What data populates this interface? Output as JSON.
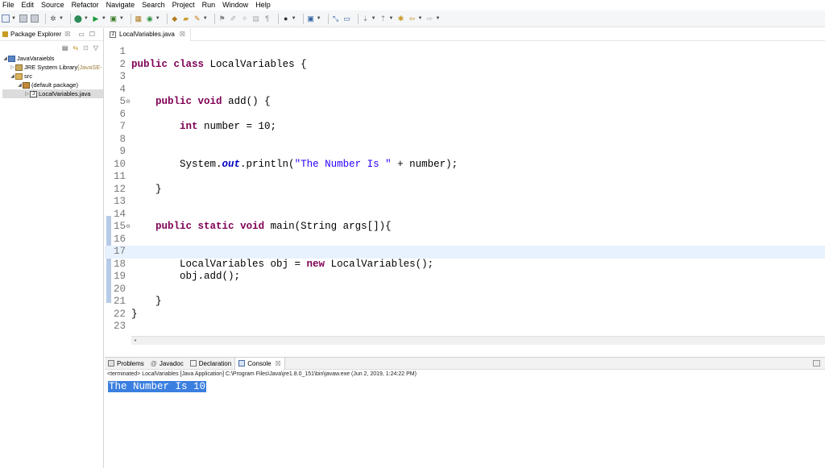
{
  "menu": [
    "File",
    "Edit",
    "Source",
    "Refactor",
    "Navigate",
    "Search",
    "Project",
    "Run",
    "Window",
    "Help"
  ],
  "package_explorer": {
    "title": "Package Explorer",
    "close": "☒",
    "tree": [
      {
        "label": "JavaVaraiebls",
        "extra": ""
      },
      {
        "label": "JRE System Library",
        "extra": " [JavaSE-"
      },
      {
        "label": "src",
        "extra": ""
      },
      {
        "label": "(default package)",
        "extra": ""
      },
      {
        "label": "LocalVariables.java",
        "extra": ""
      }
    ]
  },
  "editor": {
    "tab_label": "LocalVariables.java",
    "tab_close": "☒",
    "lines": [
      {
        "n": "1",
        "code": ""
      },
      {
        "n": "2",
        "code": "public class LocalVariables {"
      },
      {
        "n": "3",
        "code": ""
      },
      {
        "n": "4",
        "code": ""
      },
      {
        "n": "5",
        "code": "    public void add() {"
      },
      {
        "n": "6",
        "code": ""
      },
      {
        "n": "7",
        "code": "        int number = 10;"
      },
      {
        "n": "8",
        "code": ""
      },
      {
        "n": "9",
        "code": ""
      },
      {
        "n": "10",
        "code": "        System.out.println(\"The Number Is \" + number);"
      },
      {
        "n": "11",
        "code": ""
      },
      {
        "n": "12",
        "code": "    }"
      },
      {
        "n": "13",
        "code": ""
      },
      {
        "n": "14",
        "code": ""
      },
      {
        "n": "15",
        "code": "    public static void main(String args[]){"
      },
      {
        "n": "16",
        "code": ""
      },
      {
        "n": "17",
        "code": ""
      },
      {
        "n": "18",
        "code": "        LocalVariables obj = new LocalVariables();"
      },
      {
        "n": "19",
        "code": "        obj.add();"
      },
      {
        "n": "20",
        "code": ""
      },
      {
        "n": "21",
        "code": "    }"
      },
      {
        "n": "22",
        "code": "}"
      },
      {
        "n": "23",
        "code": ""
      }
    ],
    "current_line": 17
  },
  "console": {
    "tabs": [
      {
        "label": "Problems",
        "active": false
      },
      {
        "label": "Javadoc",
        "active": false
      },
      {
        "label": "Declaration",
        "active": false
      },
      {
        "label": "Console",
        "active": true
      }
    ],
    "tab_close": "☒",
    "status": "<terminated> LocalVariables [Java Application] C:\\Program Files\\Java\\jre1.8.0_151\\bin\\javaw.exe (Jun 2, 2019, 1:24:22 PM)",
    "output": "The Number Is 10"
  },
  "colors": {
    "keyword": "#7f0055",
    "string": "#2a00ff",
    "static_field": "#0000c0",
    "selection": "#3b7fe0",
    "current_line": "#e8f2fe"
  }
}
